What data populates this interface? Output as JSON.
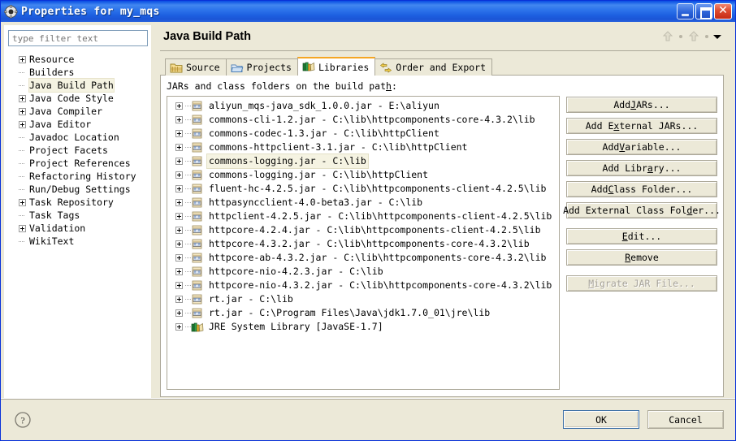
{
  "window": {
    "title": "Properties for my_mqs",
    "icon": "gear-icon",
    "minimize_label": "Minimize",
    "maximize_label": "Maximize",
    "close_label": "Close"
  },
  "sidebar": {
    "filter_placeholder": "type filter text",
    "filter_value": "",
    "items": [
      {
        "label": "Resource",
        "expandable": true,
        "selected": false
      },
      {
        "label": "Builders",
        "expandable": false,
        "selected": false
      },
      {
        "label": "Java Build Path",
        "expandable": false,
        "selected": true
      },
      {
        "label": "Java Code Style",
        "expandable": true,
        "selected": false
      },
      {
        "label": "Java Compiler",
        "expandable": true,
        "selected": false
      },
      {
        "label": "Java Editor",
        "expandable": true,
        "selected": false
      },
      {
        "label": "Javadoc Location",
        "expandable": false,
        "selected": false
      },
      {
        "label": "Project Facets",
        "expandable": false,
        "selected": false
      },
      {
        "label": "Project References",
        "expandable": false,
        "selected": false
      },
      {
        "label": "Refactoring History",
        "expandable": false,
        "selected": false
      },
      {
        "label": "Run/Debug Settings",
        "expandable": false,
        "selected": false
      },
      {
        "label": "Task Repository",
        "expandable": true,
        "selected": false
      },
      {
        "label": "Task Tags",
        "expandable": false,
        "selected": false
      },
      {
        "label": "Validation",
        "expandable": true,
        "selected": false
      },
      {
        "label": "WikiText",
        "expandable": false,
        "selected": false
      }
    ]
  },
  "page": {
    "title": "Java Build Path",
    "nav_back": "back-arrow",
    "nav_forward": "forward-arrow",
    "nav_menu": "view-menu-chevron"
  },
  "tabs": [
    {
      "label": "Source",
      "icon": "source-folder-icon",
      "active": false
    },
    {
      "label": "Projects",
      "icon": "projects-folder-icon",
      "active": false
    },
    {
      "label": "Libraries",
      "icon": "libraries-books-icon",
      "active": true
    },
    {
      "label": "Order and Export",
      "icon": "order-export-icon",
      "active": false
    }
  ],
  "panel": {
    "label_prefix": "JARs and class folders on the build pat",
    "label_mnemonic": "h",
    "label_suffix": ":"
  },
  "jars": [
    {
      "name": "aliyun_mqs-java_sdk_1.0.0.jar - E:\\aliyun",
      "icon": "jar-icon",
      "selected": false
    },
    {
      "name": "commons-cli-1.2.jar - C:\\lib\\httpcomponents-core-4.3.2\\lib",
      "icon": "jar-icon",
      "selected": false
    },
    {
      "name": "commons-codec-1.3.jar - C:\\lib\\httpClient",
      "icon": "jar-icon",
      "selected": false
    },
    {
      "name": "commons-httpclient-3.1.jar - C:\\lib\\httpClient",
      "icon": "jar-icon",
      "selected": false
    },
    {
      "name": "commons-logging.jar - C:\\lib",
      "icon": "jar-icon",
      "selected": true
    },
    {
      "name": "commons-logging.jar - C:\\lib\\httpClient",
      "icon": "jar-icon",
      "selected": false
    },
    {
      "name": "fluent-hc-4.2.5.jar - C:\\lib\\httpcomponents-client-4.2.5\\lib",
      "icon": "jar-icon",
      "selected": false
    },
    {
      "name": "httpasyncclient-4.0-beta3.jar - C:\\lib",
      "icon": "jar-icon",
      "selected": false
    },
    {
      "name": "httpclient-4.2.5.jar - C:\\lib\\httpcomponents-client-4.2.5\\lib",
      "icon": "jar-icon",
      "selected": false
    },
    {
      "name": "httpcore-4.2.4.jar - C:\\lib\\httpcomponents-client-4.2.5\\lib",
      "icon": "jar-icon",
      "selected": false
    },
    {
      "name": "httpcore-4.3.2.jar - C:\\lib\\httpcomponents-core-4.3.2\\lib",
      "icon": "jar-icon",
      "selected": false
    },
    {
      "name": "httpcore-ab-4.3.2.jar - C:\\lib\\httpcomponents-core-4.3.2\\lib",
      "icon": "jar-icon",
      "selected": false
    },
    {
      "name": "httpcore-nio-4.2.3.jar - C:\\lib",
      "icon": "jar-icon",
      "selected": false
    },
    {
      "name": "httpcore-nio-4.3.2.jar - C:\\lib\\httpcomponents-core-4.3.2\\lib",
      "icon": "jar-icon",
      "selected": false
    },
    {
      "name": "rt.jar - C:\\lib",
      "icon": "jar-icon",
      "selected": false
    },
    {
      "name": "rt.jar - C:\\Program Files\\Java\\jdk1.7.0_01\\jre\\lib",
      "icon": "jar-icon",
      "selected": false
    },
    {
      "name": "JRE System Library [JavaSE-1.7]",
      "icon": "library-books-icon",
      "selected": false
    }
  ],
  "side_buttons": [
    {
      "pre": "Add ",
      "mnemonic": "J",
      "post": "ARs...",
      "disabled": false,
      "gap": false
    },
    {
      "pre": "Add E",
      "mnemonic": "x",
      "post": "ternal JARs...",
      "disabled": false,
      "gap": false
    },
    {
      "pre": "Add ",
      "mnemonic": "V",
      "post": "ariable...",
      "disabled": false,
      "gap": false
    },
    {
      "pre": "Add Libr",
      "mnemonic": "a",
      "post": "ry...",
      "disabled": false,
      "gap": false
    },
    {
      "pre": "Add ",
      "mnemonic": "C",
      "post": "lass Folder...",
      "disabled": false,
      "gap": false
    },
    {
      "pre": "Add External Class Fol",
      "mnemonic": "d",
      "post": "er...",
      "disabled": false,
      "gap": false
    },
    {
      "pre": "",
      "mnemonic": "E",
      "post": "dit...",
      "disabled": false,
      "gap": true
    },
    {
      "pre": "",
      "mnemonic": "R",
      "post": "emove",
      "disabled": false,
      "gap": false
    },
    {
      "pre": "",
      "mnemonic": "M",
      "post": "igrate JAR File...",
      "disabled": true,
      "gap": true
    }
  ],
  "footer": {
    "help_icon": "help-question-icon",
    "ok_label": "OK",
    "cancel_label": "Cancel"
  },
  "colors": {
    "titlebar_blue": "#1e64e8",
    "dialog_bg": "#ece9d8",
    "selection_bg": "#f5f3e2",
    "active_tab_accent": "#f5a623",
    "close_red": "#c62a14"
  }
}
